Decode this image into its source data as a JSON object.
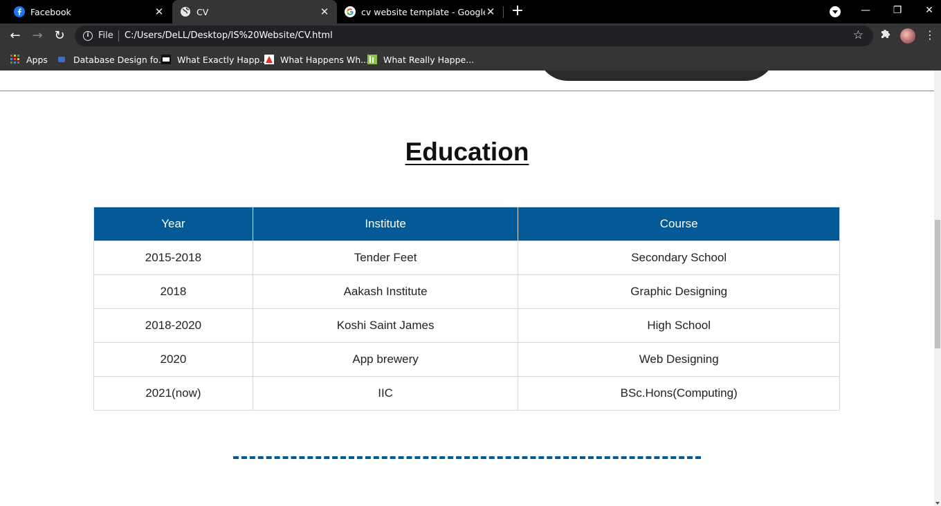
{
  "browser": {
    "tabs": [
      {
        "title": "Facebook",
        "icon": "facebook-icon",
        "active": false,
        "close": "✕"
      },
      {
        "title": "CV",
        "icon": "globe-icon",
        "active": true,
        "close": "✕"
      },
      {
        "title": "cv website template - Google Se",
        "icon": "google-icon",
        "active": false,
        "close": "✕"
      }
    ],
    "new_tab": "+",
    "window_controls": {
      "minimize": "—",
      "restore": "❐",
      "close": "✕"
    },
    "address": {
      "scheme_label": "File",
      "url": "C:/Users/DeLL/Desktop/IS%20Website/CV.html"
    },
    "bookmarks": [
      {
        "label": "Apps",
        "icon": "apps-grid-icon"
      },
      {
        "label": "Database Design fo...",
        "icon": "database-icon"
      },
      {
        "label": "What Exactly Happ...",
        "icon": "htg-icon"
      },
      {
        "label": "What Happens Wh...",
        "icon": "triangle-icon"
      },
      {
        "label": "What Really Happe...",
        "icon": "lh-icon"
      }
    ]
  },
  "page": {
    "heading": "Education",
    "table": {
      "headers": [
        "Year",
        "Institute",
        "Course"
      ],
      "rows": [
        [
          "2015-2018",
          "Tender Feet",
          "Secondary School"
        ],
        [
          "2018",
          "Aakash Institute",
          "Graphic Designing"
        ],
        [
          "2018-2020",
          "Koshi Saint James",
          "High School"
        ],
        [
          "2020",
          "App brewery",
          "Web Designing"
        ],
        [
          "2021(now)",
          "IIC",
          "BSc.Hons(Computing)"
        ]
      ]
    }
  },
  "colors": {
    "accent": "#035a96",
    "chrome_dark": "#353535",
    "tabbar": "#000000"
  }
}
